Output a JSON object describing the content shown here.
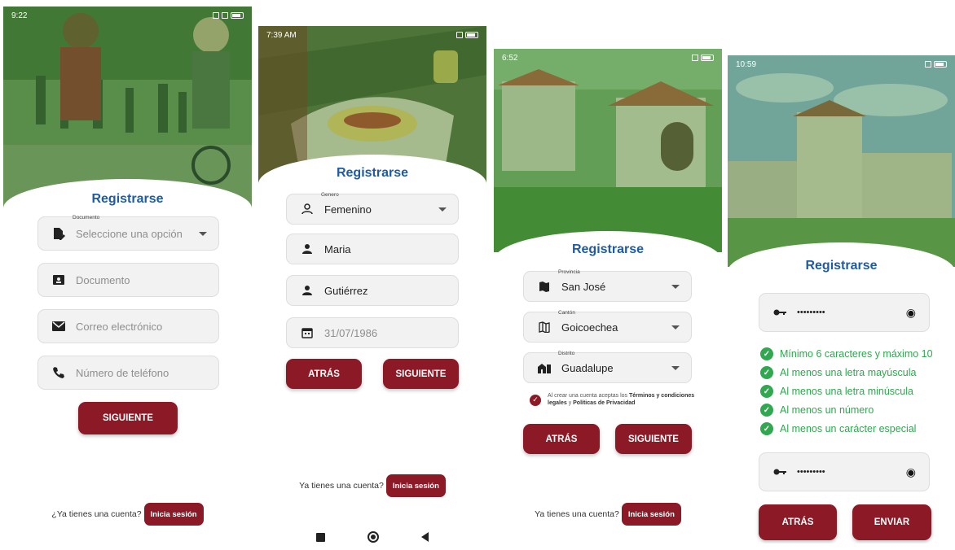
{
  "screens": [
    {
      "status_time": "9:22",
      "title": "Registrarse",
      "document_type": {
        "label": "Documento",
        "value": "Seleccione una opción"
      },
      "document_field": {
        "placeholder": "Documento"
      },
      "email_field": {
        "placeholder": "Correo electrónico"
      },
      "phone_field": {
        "placeholder": "Número de teléfono"
      },
      "next_button": "SIGUIENTE",
      "login_prompt": "¿Ya tienes una cuenta?",
      "login_button": "Inicia sesión"
    },
    {
      "status_time": "7:39 AM",
      "title": "Registrarse",
      "gender": {
        "label": "Genero",
        "value": "Femenino"
      },
      "first_name": "Maria",
      "last_name": "Gutiérrez",
      "birth_date": "31/07/1986",
      "back_button": "ATRÁS",
      "next_button": "SIGUIENTE",
      "login_prompt": "Ya tienes una cuenta?",
      "login_button": "Inicia sesión"
    },
    {
      "status_time": "6:52",
      "title": "Registrarse",
      "province": {
        "label": "Provincia",
        "value": "San José"
      },
      "canton": {
        "label": "Cantón",
        "value": "Goicoechea"
      },
      "district": {
        "label": "Distrito",
        "value": "Guadalupe"
      },
      "terms": {
        "prefix": "Al crear una cuenta aceptas los ",
        "terms_link": "Términos y condiciones legales",
        "middle": " y ",
        "privacy_link": "Políticas de Privacidad"
      },
      "back_button": "ATRÁS",
      "next_button": "SIGUIENTE",
      "login_prompt": "Ya tienes una cuenta?",
      "login_button": "Inicia sesión"
    },
    {
      "status_time": "10:59",
      "title": "Registrarse",
      "password": "•••••••••",
      "rules": [
        "Mínimo 6 caracteres y máximo 10",
        "Al menos una letra mayúscula",
        "Al menos una letra minúscula",
        "Al menos un número",
        "Al menos un carácter especial"
      ],
      "confirm_password": "•••••••••",
      "back_button": "ATRÁS",
      "send_button": "ENVIAR"
    }
  ],
  "colors": {
    "primary": "#8b1a26",
    "title_blue": "#1f5aa6",
    "success": "#2fa84f",
    "hero_tint": "#2e8b2e"
  }
}
